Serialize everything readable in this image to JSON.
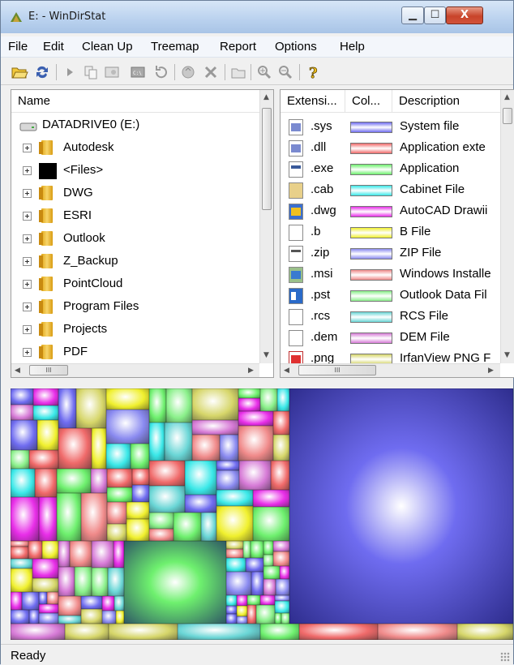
{
  "window": {
    "title": "E: - WinDirStat",
    "min_glyph": "▁",
    "max_glyph": "☐",
    "close_glyph": "X"
  },
  "menu": [
    "File",
    "Edit",
    "Clean Up",
    "Treemap",
    "Report",
    "Options",
    "Help"
  ],
  "toolbar_icons": [
    "open-folder-icon",
    "refresh-icon",
    "play-icon",
    "copy-icon",
    "explorer-icon",
    "command-prompt-icon",
    "undo-icon",
    "recycle-icon",
    "delete-icon",
    "new-folder-icon",
    "zoom-in-icon",
    "zoom-out-icon",
    "help-icon"
  ],
  "tree": {
    "header": "Name",
    "root": "DATADRIVE0 (E:)",
    "items": [
      {
        "label": "Autodesk",
        "icon": "folder-icon"
      },
      {
        "label": "<Files>",
        "icon": "files-icon"
      },
      {
        "label": "DWG",
        "icon": "folder-icon"
      },
      {
        "label": "ESRI",
        "icon": "folder-icon"
      },
      {
        "label": "Outlook",
        "icon": "folder-icon"
      },
      {
        "label": "Z_Backup",
        "icon": "folder-icon"
      },
      {
        "label": "PointCloud",
        "icon": "folder-icon"
      },
      {
        "label": "Program Files",
        "icon": "folder-icon"
      },
      {
        "label": "Projects",
        "icon": "folder-icon"
      },
      {
        "label": "PDF",
        "icon": "folder-icon"
      }
    ],
    "hscroll_label": "III"
  },
  "extensions": {
    "headers": {
      "ext": "Extensi...",
      "color": "Col...",
      "desc": "Description"
    },
    "rows": [
      {
        "ext": ".sys",
        "desc": "System file",
        "color": "#6f6cf0"
      },
      {
        "ext": ".dll",
        "desc": "Application exte",
        "color": "#f06a6a"
      },
      {
        "ext": ".exe",
        "desc": "Application",
        "color": "#6ef06e"
      },
      {
        "ext": ".cab",
        "desc": "Cabinet File",
        "color": "#3ae8e8"
      },
      {
        "ext": ".dwg",
        "desc": "AutoCAD Drawii",
        "color": "#e82ee8"
      },
      {
        "ext": ".b",
        "desc": "B File",
        "color": "#f0f02e"
      },
      {
        "ext": ".zip",
        "desc": "ZIP File",
        "color": "#8a8af0"
      },
      {
        "ext": ".msi",
        "desc": "Windows Installe",
        "color": "#f08a8a"
      },
      {
        "ext": ".pst",
        "desc": "Outlook Data Fil",
        "color": "#8af08a"
      },
      {
        "ext": ".rcs",
        "desc": "RCS File",
        "color": "#6ad6d6"
      },
      {
        "ext": ".dem",
        "desc": "DEM File",
        "color": "#d67ad6"
      },
      {
        "ext": ".png",
        "desc": "IrfanView PNG F",
        "color": "#d6d66a"
      }
    ],
    "hscroll_label": "III"
  },
  "status": {
    "text": "Ready"
  }
}
